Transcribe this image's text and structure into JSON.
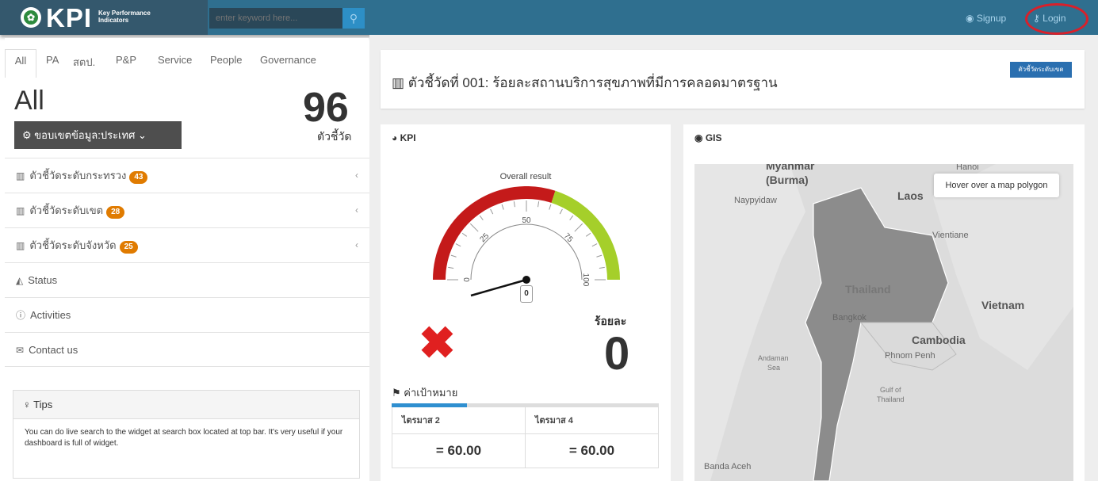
{
  "topbar": {
    "logo_text": "KPI",
    "logo_sub": "Key Performance Indicators",
    "search_placeholder": "enter keyword here...",
    "signup": "Signup",
    "login": "Login"
  },
  "sidebar": {
    "tabs": [
      "All",
      "PA",
      "สตป.",
      "P&P",
      "Service",
      "People",
      "Governance"
    ],
    "heading": "All",
    "count": "96",
    "count_label": "ตัวชี้วัด",
    "scope_button": "ขอบเขตข้อมูล:ประเทศ",
    "menu": [
      {
        "label": "ตัวชี้วัดระดับกระทรวง",
        "badge": "43"
      },
      {
        "label": "ตัวชี้วัดระดับเขต",
        "badge": "28"
      },
      {
        "label": "ตัวชี้วัดระดับจังหวัด",
        "badge": "25"
      },
      {
        "label": "Status"
      },
      {
        "label": "Activities"
      },
      {
        "label": "Contact us"
      }
    ],
    "tips": {
      "title": "Tips",
      "body": "You can do live search to the widget at search box located at top bar. It's very useful if your dashboard is full of widget."
    }
  },
  "main": {
    "title": "ตัวชี้วัดที่ 001: ร้อยละสถานบริการสุขภาพที่มีการคลอดมาตรฐาน",
    "title_button": "ตัวชี้วัดระดับเขต",
    "kpi": {
      "heading": "KPI",
      "gauge_title": "Overall result",
      "gauge_ticks": [
        "0",
        "25",
        "50",
        "75",
        "100"
      ],
      "gauge_value": 0,
      "gauge_value_label": "0",
      "percent_label": "ร้อยละ",
      "result": "0",
      "target_label": "ค่าเป้าหมาย",
      "targets": [
        {
          "quarter": "ไตรมาส 2",
          "value": "= 60.00"
        },
        {
          "quarter": "ไตรมาส 4",
          "value": "= 60.00"
        }
      ]
    },
    "gis": {
      "heading": "GIS",
      "hover_hint": "Hover over a map polygon",
      "labels": [
        "Myanmar",
        "(Burma)",
        "Naypyidaw",
        "Laos",
        "Hanoi",
        "Vientiane",
        "Thailand",
        "Bangkok",
        "Vietnam",
        "Cambodia",
        "Phnom Penh",
        "Andaman",
        "Sea",
        "Gulf of",
        "Thailand",
        "Banda Aceh"
      ]
    }
  }
}
